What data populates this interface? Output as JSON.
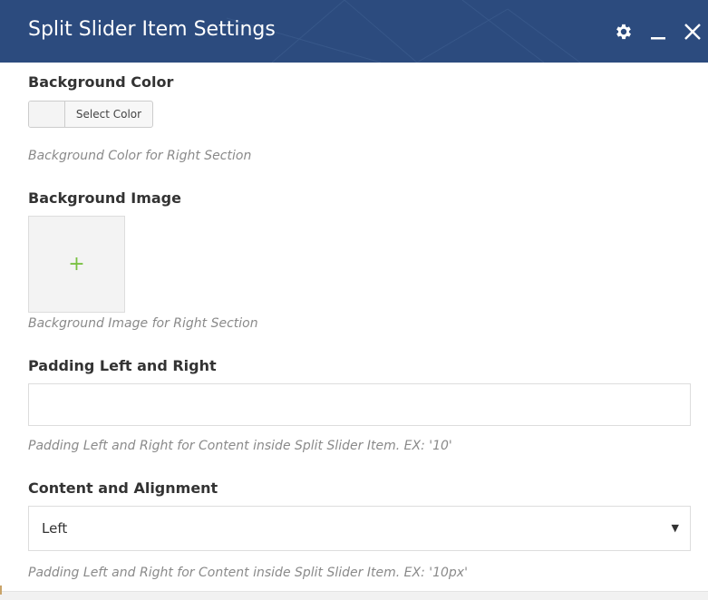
{
  "modal": {
    "title": "Split Slider Item Settings",
    "header_color": "#2c4b7e",
    "icons": [
      "gear-icon",
      "minimize-icon",
      "close-icon"
    ]
  },
  "fields": {
    "background_color": {
      "label": "Background Color",
      "button_label": "Select Color",
      "description": "Background Color for Right Section"
    },
    "background_image": {
      "label": "Background Image",
      "button_icon": "plus-icon",
      "button_glyph": "+",
      "description": "Background Image for Right Section"
    },
    "padding": {
      "label": "Padding Left and Right",
      "value": "",
      "description": "Padding Left and Right for Content inside Split Slider Item. EX: '10'"
    },
    "alignment": {
      "label": "Content and Alignment",
      "selected": "Left",
      "arrow": "▼",
      "description": "Padding Left and Right for Content inside Split Slider Item. EX: '10px'"
    }
  }
}
